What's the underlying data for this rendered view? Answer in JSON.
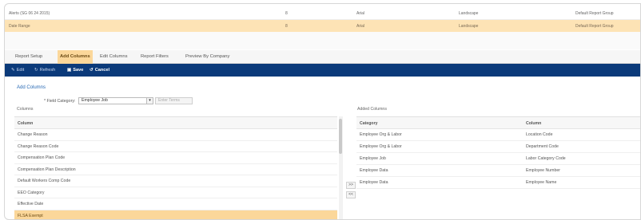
{
  "report_rows": [
    {
      "name": "Alerts (SG 06 24 2015)",
      "size": "8",
      "font": "Arial",
      "orientation": "Landscape",
      "group": "Default Report Group"
    },
    {
      "name": "Date Range",
      "size": "8",
      "font": "Arial",
      "orientation": "Landscape",
      "group": "Default Report Group"
    }
  ],
  "tabs": [
    "Report Setup",
    "Add Columns",
    "Edit Columns",
    "Report Filters",
    "Preview By Company"
  ],
  "active_tab": 1,
  "toolbar": {
    "edit": "Edit",
    "refresh": "Refresh",
    "save": "Save",
    "cancel": "Cancel"
  },
  "section_title": "Add Columns",
  "field_category": {
    "label": "* Field Category:",
    "value": "Employee Job",
    "filter_placeholder": "Enter Terms"
  },
  "columns_label": "Columns",
  "added_columns_label": "Added Columns",
  "left_list": {
    "header": "Column",
    "items": [
      "Change Reason",
      "Change Reason Code",
      "Compensation Plan Code",
      "Compensation Plan Description",
      "Default Workers Comp Code",
      "EEO Category",
      "Effective Date",
      "FLSA Exempt"
    ],
    "selected_index": 7
  },
  "move_buttons": {
    "add": ">>",
    "remove": "<<"
  },
  "added_table": {
    "headers": [
      "Category",
      "Column"
    ],
    "rows": [
      [
        "Employee Org & Labor",
        "Location Code"
      ],
      [
        "Employee Org & Labor",
        "Department Code"
      ],
      [
        "Employee Job",
        "Labor Category Code"
      ],
      [
        "Employee Data",
        "Employee Number"
      ],
      [
        "Employee Data",
        "Employee Name"
      ]
    ]
  },
  "icons": {
    "edit": "pencil-icon",
    "refresh": "refresh-icon",
    "save": "floppy-icon",
    "cancel": "undo-icon"
  },
  "colors": {
    "toolbar_bg": "#0b3a7a",
    "highlight": "#fbd79a",
    "link": "#2a6bb5"
  }
}
